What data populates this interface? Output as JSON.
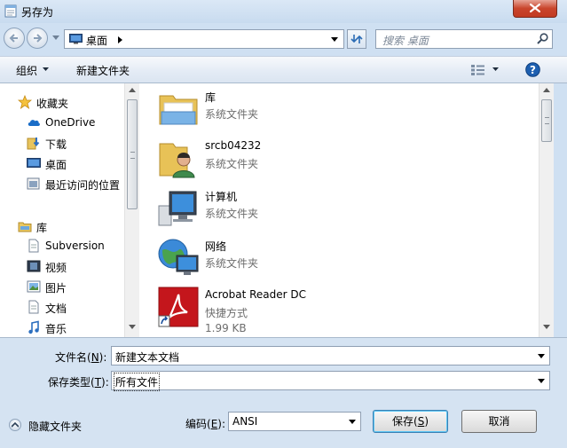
{
  "window": {
    "title": "另存为",
    "close_icon": "close-icon"
  },
  "address": {
    "location": "桌面",
    "location_icon": "desktop-icon"
  },
  "search": {
    "placeholder": "搜索 桌面"
  },
  "toolbar": {
    "organize": "组织",
    "new_folder": "新建文件夹",
    "view_icon": "view-options-icon",
    "help_icon": "help-icon"
  },
  "sidebar": {
    "favorites": {
      "label": "收藏夹",
      "items": [
        {
          "label": "OneDrive",
          "icon": "cloud-icon"
        },
        {
          "label": "下载",
          "icon": "downloads-folder-icon"
        },
        {
          "label": "桌面",
          "icon": "desktop-icon"
        },
        {
          "label": "最近访问的位置",
          "icon": "recent-places-icon"
        }
      ]
    },
    "libraries": {
      "label": "库",
      "items": [
        {
          "label": "Subversion",
          "icon": "document-icon"
        },
        {
          "label": "视频",
          "icon": "video-icon"
        },
        {
          "label": "图片",
          "icon": "picture-icon"
        },
        {
          "label": "文档",
          "icon": "document-icon"
        },
        {
          "label": "音乐",
          "icon": "music-icon"
        }
      ]
    }
  },
  "files": [
    {
      "name": "库",
      "type": "系统文件夹",
      "icon": "libraries-folder-icon"
    },
    {
      "name": "srcb04232",
      "type": "系统文件夹",
      "icon": "user-folder-icon"
    },
    {
      "name": "计算机",
      "type": "系统文件夹",
      "icon": "computer-icon"
    },
    {
      "name": "网络",
      "type": "系统文件夹",
      "icon": "network-icon"
    },
    {
      "name": "Acrobat Reader DC",
      "type": "快捷方式",
      "size": "1.99 KB",
      "icon": "acrobat-shortcut-icon"
    }
  ],
  "form": {
    "filename_label": "文件名(",
    "filename_key": "N",
    "filename_label_end": "):",
    "filename_value": "新建文本文档",
    "filetype_label": "保存类型(",
    "filetype_key": "T",
    "filetype_label_end": "):",
    "filetype_value": "所有文件",
    "encoding_label": "编码(",
    "encoding_key": "E",
    "encoding_label_end": "):",
    "encoding_value": "ANSI"
  },
  "buttons": {
    "hide_folders": "隐藏文件夹",
    "save": "保存(",
    "save_key": "S",
    "save_end": ")",
    "cancel": "取消"
  }
}
